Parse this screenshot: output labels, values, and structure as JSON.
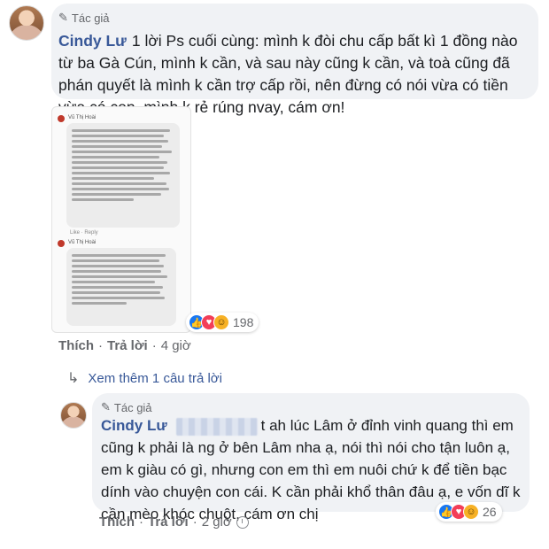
{
  "comment1": {
    "badge": "Tác giả",
    "author": "Cindy Lư",
    "text": "1 lời Ps cuối cùng: mình k đòi chu cấp bất kì 1 đồng nào từ ba Gà Cún, mình k cần, và sau này cũng k cần, và toà cũng đã phán quyết là mình k cần trợ cấp rồi, nên đừng có nói vừa có tiền vừa có con, mình k rẻ rúng nvay, cám ơn!",
    "screenshot": {
      "first_author": "Vũ Thị Hoài",
      "second_author": "Vũ Thị Hoài",
      "first_text": "Xo bênh Lâm, nhưng chuyện gì cũng từ 2 phía. Cô gái mất thanh xuân, Lâm cũng vậy. Cô gái ấy thành mẹ đơn thân, Lâm là ông bố mất con đủ thương con...",
      "second_text": "Bonus thêm là Lâm ko hề \"khóa rồi có cần lo gì đâu\". Vì nuôi con vẫn là trách nhiệm 2 bên...",
      "mini_actions": "Like · Reply"
    },
    "reaction_count": "198",
    "actions": {
      "like": "Thích",
      "reply": "Trả lời",
      "time": "4 giờ"
    }
  },
  "see_more": "Xem thêm 1 câu trả lời",
  "reply1": {
    "badge": "Tác giả",
    "author": "Cindy Lư",
    "text_tail": "t ah lúc Lâm ở đỉnh vinh quang thì em",
    "text_body": "cũng k phải là ng ở bên Lâm nha ạ, nói thì nói cho tận luôn ạ, em k giàu có gì, nhưng con em thì em nuôi chứ k để tiền bạc dính vào chuyện con cái. K cần phải khổ thân đâu ạ, e vốn dĩ k cần mèo khóc chuột, cám ơn chị",
    "reaction_count": "26",
    "actions": {
      "like": "Thích",
      "reply": "Trả lời",
      "time": "2 giờ"
    }
  },
  "icons": {
    "badge": "pencil-icon",
    "like": "like-reaction-icon",
    "love": "love-reaction-icon",
    "haha": "haha-reaction-icon",
    "time": "clock-icon",
    "reply_arrow": "reply-arrow-icon"
  },
  "colors": {
    "link": "#385898",
    "bubble": "#f0f2f5",
    "meta": "#65676b"
  }
}
